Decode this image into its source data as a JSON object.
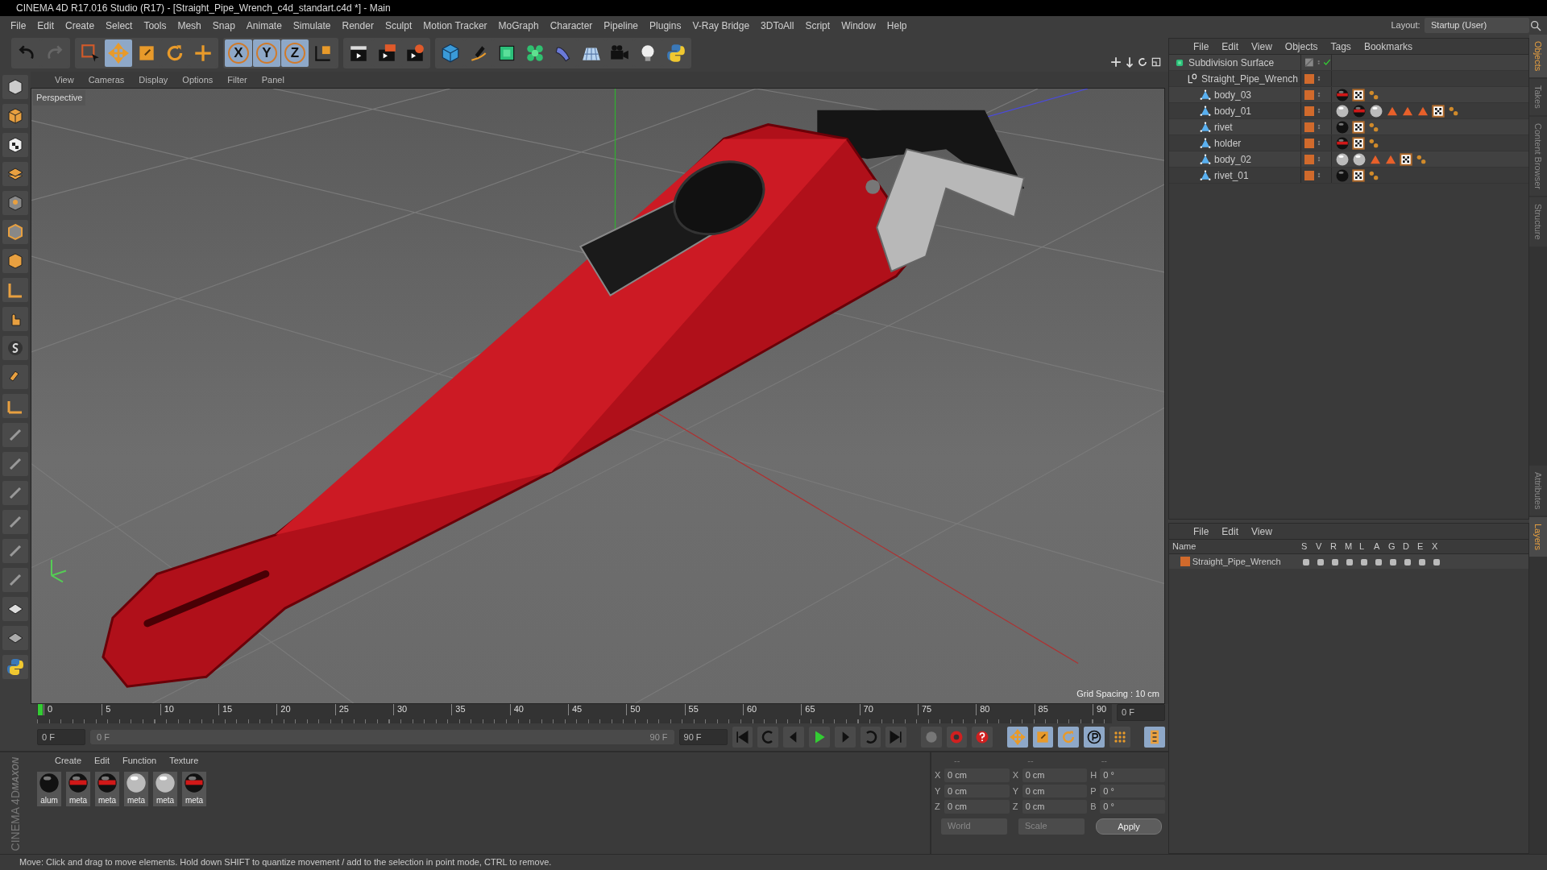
{
  "window": {
    "title": "CINEMA 4D R17.016 Studio (R17) - [Straight_Pipe_Wrench_c4d_standart.c4d *] - Main"
  },
  "menu": [
    "File",
    "Edit",
    "Create",
    "Select",
    "Tools",
    "Mesh",
    "Snap",
    "Animate",
    "Simulate",
    "Render",
    "Sculpt",
    "Motion Tracker",
    "MoGraph",
    "Character",
    "Pipeline",
    "Plugins",
    "V-Ray Bridge",
    "3DToAll",
    "Script",
    "Window",
    "Help"
  ],
  "layout": {
    "label": "Layout:",
    "value": "Startup (User)"
  },
  "toolbar": [
    {
      "kind": "undo",
      "selected": false
    },
    {
      "kind": "redo",
      "selected": false
    },
    {
      "kind": "select",
      "selected": false
    },
    {
      "kind": "move",
      "selected": true
    },
    {
      "kind": "scale",
      "selected": false
    },
    {
      "kind": "rotate",
      "selected": false
    },
    {
      "kind": "transform",
      "selected": false
    },
    {
      "kind": "axis",
      "label": "X",
      "selected": true
    },
    {
      "kind": "axis",
      "label": "Y",
      "selected": true
    },
    {
      "kind": "axis",
      "label": "Z",
      "selected": true
    },
    {
      "kind": "coords",
      "selected": false
    },
    {
      "kind": "render-view",
      "selected": false
    },
    {
      "kind": "render",
      "selected": false
    },
    {
      "kind": "render-settings",
      "selected": false
    },
    {
      "kind": "cube",
      "selected": false
    },
    {
      "kind": "pen",
      "selected": false
    },
    {
      "kind": "subdivision",
      "selected": false
    },
    {
      "kind": "cloner",
      "selected": false
    },
    {
      "kind": "deformer",
      "selected": false
    },
    {
      "kind": "floor",
      "selected": false
    },
    {
      "kind": "camera",
      "selected": false
    },
    {
      "kind": "light",
      "selected": false
    },
    {
      "kind": "python",
      "selected": false
    }
  ],
  "viewport": {
    "menu": [
      "View",
      "Cameras",
      "Display",
      "Options",
      "Filter",
      "Panel"
    ],
    "camera": "Perspective",
    "grid_spacing": "Grid Spacing : 10 cm"
  },
  "timeline": {
    "ticks": [
      "0",
      "5",
      "10",
      "15",
      "20",
      "25",
      "30",
      "35",
      "40",
      "45",
      "50",
      "55",
      "60",
      "65",
      "70",
      "75",
      "80",
      "85",
      "90"
    ],
    "current_frame": "0 F",
    "start": "0 F",
    "range": {
      "start": "0 F",
      "end": "90 F",
      "level": 1
    },
    "end": "90 F"
  },
  "materials": {
    "menu": [
      "Create",
      "Edit",
      "Function",
      "Texture"
    ],
    "items": [
      {
        "name": "alum",
        "kind": "black"
      },
      {
        "name": "meta",
        "kind": "red"
      },
      {
        "name": "meta",
        "kind": "red"
      },
      {
        "name": "meta",
        "kind": "silver"
      },
      {
        "name": "meta",
        "kind": "silver"
      },
      {
        "name": "meta",
        "kind": "red"
      }
    ]
  },
  "brand": {
    "top": "MAXON",
    "bottom": "CINEMA 4D"
  },
  "coordinates": {
    "headers": [
      "--",
      "--",
      "--"
    ],
    "columns": [
      [
        {
          "axis": "X",
          "value": "0 cm"
        },
        {
          "axis": "Y",
          "value": "0 cm"
        },
        {
          "axis": "Z",
          "value": "0 cm"
        }
      ],
      [
        {
          "axis": "X",
          "value": "0 cm"
        },
        {
          "axis": "Y",
          "value": "0 cm"
        },
        {
          "axis": "Z",
          "value": "0 cm"
        }
      ],
      [
        {
          "axis": "H",
          "value": "0 °"
        },
        {
          "axis": "P",
          "value": "0 °"
        },
        {
          "axis": "B",
          "value": "0 °"
        }
      ]
    ],
    "dropdowns": [
      "World",
      "Scale"
    ],
    "apply": "Apply"
  },
  "objects": {
    "menu": [
      "File",
      "Edit",
      "View",
      "Objects",
      "Tags",
      "Bookmarks"
    ],
    "tree": [
      {
        "name": "Subdivision Surface",
        "kind": "subdivision",
        "enabled": true,
        "children": [
          {
            "name": "Straight_Pipe_Wrench",
            "kind": "null",
            "color": "#d06a2c",
            "children": [
              {
                "name": "body_03",
                "kind": "polygon",
                "color": "#d06a2c",
                "tags": [
                  {
                    "kind": "red"
                  },
                  {
                    "kind": "checker"
                  },
                  {
                    "kind": "dots"
                  }
                ]
              },
              {
                "name": "body_01",
                "kind": "polygon",
                "color": "#d06a2c",
                "tags": [
                  {
                    "kind": "silver"
                  },
                  {
                    "kind": "red"
                  },
                  {
                    "kind": "silver"
                  },
                  {
                    "kind": "triangle"
                  },
                  {
                    "kind": "triangle"
                  },
                  {
                    "kind": "triangle"
                  },
                  {
                    "kind": "checker"
                  },
                  {
                    "kind": "dots"
                  }
                ]
              },
              {
                "name": "rivet",
                "kind": "polygon",
                "color": "#d06a2c",
                "tags": [
                  {
                    "kind": "black"
                  },
                  {
                    "kind": "checker"
                  },
                  {
                    "kind": "dots"
                  }
                ]
              },
              {
                "name": "holder",
                "kind": "polygon",
                "color": "#d06a2c",
                "tags": [
                  {
                    "kind": "red"
                  },
                  {
                    "kind": "checker"
                  },
                  {
                    "kind": "dots"
                  }
                ]
              },
              {
                "name": "body_02",
                "kind": "polygon",
                "color": "#d06a2c",
                "tags": [
                  {
                    "kind": "silver"
                  },
                  {
                    "kind": "silver"
                  },
                  {
                    "kind": "triangle"
                  },
                  {
                    "kind": "triangle"
                  },
                  {
                    "kind": "checker"
                  },
                  {
                    "kind": "dots"
                  }
                ]
              },
              {
                "name": "rivet_01",
                "kind": "polygon",
                "color": "#d06a2c",
                "tags": [
                  {
                    "kind": "black"
                  },
                  {
                    "kind": "checker"
                  },
                  {
                    "kind": "dots"
                  }
                ]
              }
            ]
          }
        ]
      }
    ]
  },
  "side_tabs_top": [
    {
      "label": "Objects",
      "selected": true
    },
    {
      "label": "Takes",
      "selected": false
    },
    {
      "label": "Content Browser",
      "selected": false
    },
    {
      "label": "Structure",
      "selected": false
    }
  ],
  "layers": {
    "menu": [
      "File",
      "Edit",
      "View"
    ],
    "columns": [
      "Name",
      "S",
      "V",
      "R",
      "M",
      "L",
      "A",
      "G",
      "D",
      "E",
      "X"
    ],
    "rows": [
      {
        "name": "Straight_Pipe_Wrench",
        "color": "#d06a2c"
      }
    ]
  },
  "side_tabs_bottom": [
    {
      "label": "Attributes",
      "selected": false
    },
    {
      "label": "Layers",
      "selected": true
    }
  ],
  "status": "Move: Click and drag to move elements. Hold down SHIFT to quantize movement / add to the selection in point mode, CTRL to remove."
}
